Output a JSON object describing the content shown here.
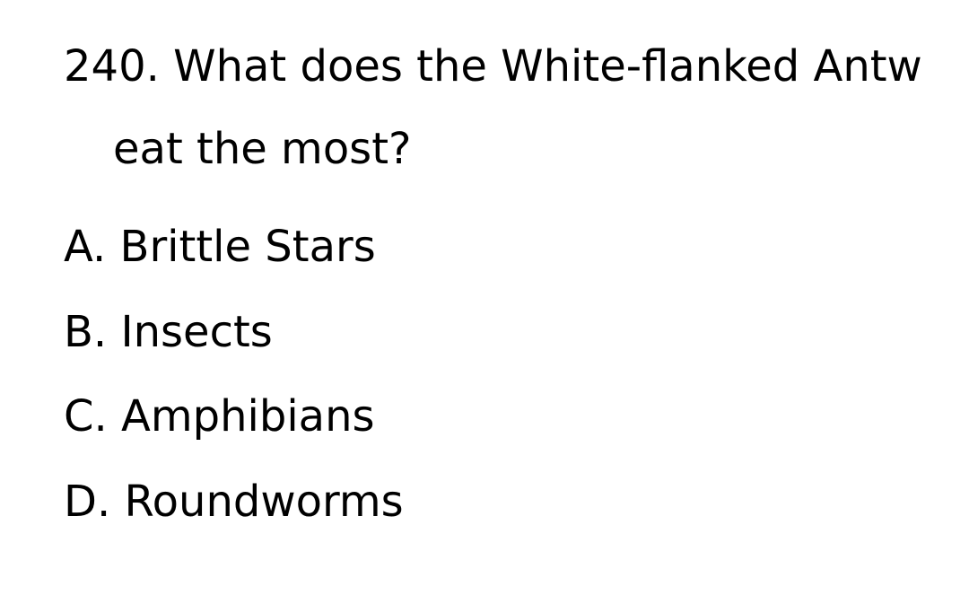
{
  "question": {
    "line1": "240. What does the White-flanked Antw",
    "line2": "eat the most?"
  },
  "options": [
    "A. Brittle Stars",
    "B. Insects",
    "C. Amphibians",
    "D. Roundworms"
  ]
}
